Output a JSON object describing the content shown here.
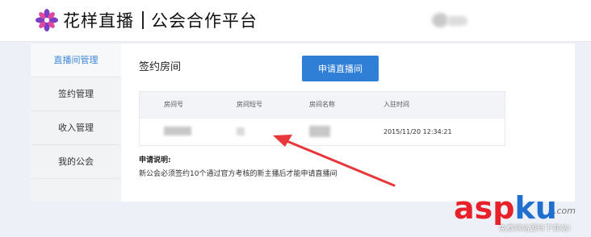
{
  "header": {
    "brand_name": "花样直播",
    "brand_platform": "公会合作平台"
  },
  "sidebar": {
    "items": [
      {
        "label": "直播间管理",
        "active": true
      },
      {
        "label": "签约管理",
        "active": false
      },
      {
        "label": "收入管理",
        "active": false
      },
      {
        "label": "我的公会",
        "active": false
      }
    ]
  },
  "main": {
    "title": "签约房间",
    "apply_button": "申请直播间",
    "table": {
      "columns": [
        "房间号",
        "房间短号",
        "房间名称",
        "入驻时间"
      ],
      "rows": [
        {
          "join_time": "2015/11/20 12:34:21"
        }
      ]
    },
    "note": {
      "title": "申请说明:",
      "text": "新公会必须签约10个通过官方考核的新主播后才能申请直播间"
    }
  },
  "watermark": {
    "text_red": "asp",
    "text_blue": "ku",
    "com": ".com",
    "sub": "免费网站源码下载站!"
  },
  "colors": {
    "accent": "#2f7fd6",
    "active_text": "#3d86d8",
    "arrow": "#e8373a",
    "background": "#edf0f6"
  }
}
